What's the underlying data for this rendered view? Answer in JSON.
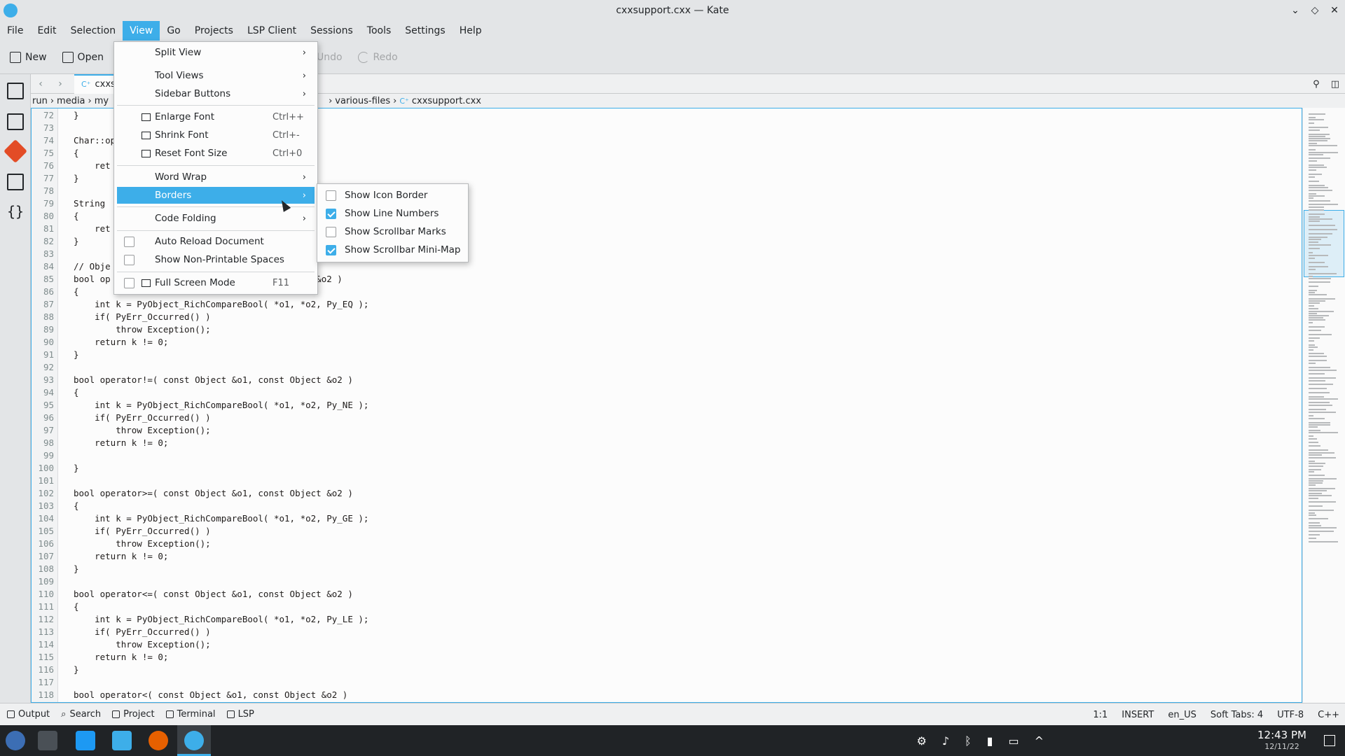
{
  "window": {
    "title": "cxxsupport.cxx — Kate",
    "controls": [
      "⌄",
      "◇",
      "✕"
    ]
  },
  "menubar": [
    "File",
    "Edit",
    "Selection",
    "View",
    "Go",
    "Projects",
    "LSP Client",
    "Sessions",
    "Tools",
    "Settings",
    "Help"
  ],
  "toolbar": {
    "new": "New",
    "open": "Open",
    "undo": "Undo",
    "redo": "Redo"
  },
  "tab": {
    "label": "cxxsu",
    "nav_back": "‹",
    "nav_forward": "›"
  },
  "breadcrumb": {
    "left": [
      "run",
      "media",
      "my"
    ],
    "right": [
      "various-files",
      "cxxsupport.cxx"
    ]
  },
  "view_menu": {
    "items": [
      {
        "label": "Split View",
        "submenu": true
      },
      {
        "label": "Tool Views",
        "submenu": true
      },
      {
        "label": "Sidebar Buttons",
        "submenu": true
      },
      {
        "label": "Enlarge Font",
        "shortcut": "Ctrl++"
      },
      {
        "label": "Shrink Font",
        "shortcut": "Ctrl+-"
      },
      {
        "label": "Reset Font Size",
        "shortcut": "Ctrl+0"
      },
      {
        "label": "Word Wrap",
        "submenu": true
      },
      {
        "label": "Borders",
        "submenu": true
      },
      {
        "label": "Code Folding",
        "submenu": true
      },
      {
        "label": "Auto Reload Document",
        "checked": false
      },
      {
        "label": "Show Non-Printable Spaces",
        "checked": false
      },
      {
        "label": "Full Screen Mode",
        "shortcut": "F11",
        "checked": false
      }
    ]
  },
  "borders_menu": {
    "items": [
      {
        "label": "Show Icon Border",
        "checked": false
      },
      {
        "label": "Show Line Numbers",
        "checked": true
      },
      {
        "label": "Show Scrollbar Marks",
        "checked": false
      },
      {
        "label": "Show Scrollbar Mini-Map",
        "checked": true
      }
    ]
  },
  "code_lines": [
    {
      "n": "72",
      "t": "}"
    },
    {
      "n": "73",
      "t": ""
    },
    {
      "n": "74",
      "t": "Char::op"
    },
    {
      "n": "75",
      "t": "{"
    },
    {
      "n": "76",
      "t": "    ret"
    },
    {
      "n": "77",
      "t": "}"
    },
    {
      "n": "78",
      "t": ""
    },
    {
      "n": "79",
      "t": "String"
    },
    {
      "n": "80",
      "t": "{"
    },
    {
      "n": "81",
      "t": "    ret                                             , true );"
    },
    {
      "n": "82",
      "t": "}"
    },
    {
      "n": "83",
      "t": ""
    },
    {
      "n": "84",
      "t": "// Obje"
    },
    {
      "n": "85",
      "t": "bool op                                    ct &o2 )"
    },
    {
      "n": "86",
      "t": "{"
    },
    {
      "n": "87",
      "t": "    int k = PyObject_RichCompareBool( *o1, *o2, Py_EQ );"
    },
    {
      "n": "88",
      "t": "    if( PyErr_Occurred() )"
    },
    {
      "n": "89",
      "t": "        throw Exception();"
    },
    {
      "n": "90",
      "t": "    return k != 0;"
    },
    {
      "n": "91",
      "t": "}"
    },
    {
      "n": "92",
      "t": ""
    },
    {
      "n": "93",
      "t": "bool operator!=( const Object &o1, const Object &o2 )"
    },
    {
      "n": "94",
      "t": "{"
    },
    {
      "n": "95",
      "t": "    int k = PyObject_RichCompareBool( *o1, *o2, Py_NE );"
    },
    {
      "n": "96",
      "t": "    if( PyErr_Occurred() )"
    },
    {
      "n": "97",
      "t": "        throw Exception();"
    },
    {
      "n": "98",
      "t": "    return k != 0;"
    },
    {
      "n": "99",
      "t": ""
    },
    {
      "n": "100",
      "t": "}"
    },
    {
      "n": "101",
      "t": ""
    },
    {
      "n": "102",
      "t": "bool operator>=( const Object &o1, const Object &o2 )"
    },
    {
      "n": "103",
      "t": "{"
    },
    {
      "n": "104",
      "t": "    int k = PyObject_RichCompareBool( *o1, *o2, Py_GE );"
    },
    {
      "n": "105",
      "t": "    if( PyErr_Occurred() )"
    },
    {
      "n": "106",
      "t": "        throw Exception();"
    },
    {
      "n": "107",
      "t": "    return k != 0;"
    },
    {
      "n": "108",
      "t": "}"
    },
    {
      "n": "109",
      "t": ""
    },
    {
      "n": "110",
      "t": "bool operator<=( const Object &o1, const Object &o2 )"
    },
    {
      "n": "111",
      "t": "{"
    },
    {
      "n": "112",
      "t": "    int k = PyObject_RichCompareBool( *o1, *o2, Py_LE );"
    },
    {
      "n": "113",
      "t": "    if( PyErr_Occurred() )"
    },
    {
      "n": "114",
      "t": "        throw Exception();"
    },
    {
      "n": "115",
      "t": "    return k != 0;"
    },
    {
      "n": "116",
      "t": "}"
    },
    {
      "n": "117",
      "t": ""
    },
    {
      "n": "118",
      "t": "bool operator<( const Object &o1, const Object &o2 )"
    }
  ],
  "statusbar": {
    "tools": [
      "Output",
      "Search",
      "Project",
      "Terminal",
      "LSP"
    ],
    "cursor_pos": "1:1",
    "mode": "INSERT",
    "language_dict": "en_US",
    "indent": "Soft Tabs: 4",
    "encoding": "UTF-8",
    "syntax": "C++"
  },
  "taskbar": {
    "time": "12:43 PM",
    "date": "12/11/22"
  },
  "colors": {
    "accent": "#3daee9",
    "menu_highlight": "#3daee9",
    "git_icon": "#e34c26"
  }
}
